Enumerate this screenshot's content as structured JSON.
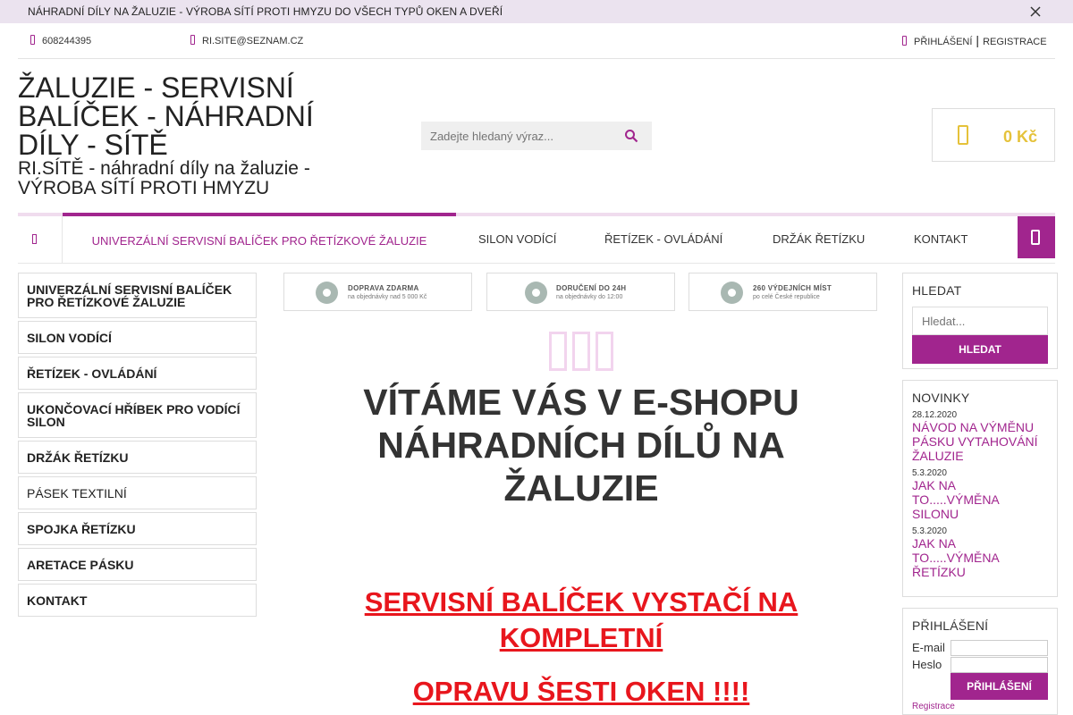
{
  "announcement": {
    "text": "NÁHRADNÍ DÍLY NA ŽALUZIE - VÝROBA SÍTÍ PROTI HMYZU DO VŠECH TYPŮ OKEN A DVEŘÍ"
  },
  "topbar": {
    "phone": "608244395",
    "email": "RI.SITE@SEZNAM.CZ",
    "login": "PŘIHLÁŠENÍ",
    "separator": "|",
    "register": "REGISTRACE"
  },
  "header": {
    "title": "ŽALUZIE - SERVISNÍ BALÍČEK - NÁHRADNÍ DÍLY - SÍTĚ",
    "subtitle": "RI.SÍTĚ - náhradní díly na žaluzie - VÝROBA SÍTÍ PROTI HMYZU",
    "search_placeholder": "Zadejte hledaný výraz...",
    "cart_total": "0 Kč"
  },
  "nav": {
    "items": [
      "UNIVERZÁLNÍ SERVISNÍ BALÍČEK PRO ŘETÍZKOVÉ ŽALUZIE",
      "SILON VODÍCÍ",
      "ŘETÍZEK - OVLÁDÁNÍ",
      "DRŽÁK ŘETÍZKU",
      "KONTAKT"
    ]
  },
  "sidebar": {
    "categories": [
      "UNIVERZÁLNÍ SERVISNÍ BALÍČEK PRO ŘETÍZKOVÉ ŽALUZIE",
      "SILON VODÍCÍ",
      "ŘETÍZEK - OVLÁDÁNÍ",
      "UKONČOVACÍ HŘÍBEK PRO VODÍCÍ SILON",
      "DRŽÁK ŘETÍZKU",
      "PÁSEK TEXTILNÍ",
      "SPOJKA ŘETÍZKU",
      "ARETACE PÁSKU",
      "KONTAKT"
    ]
  },
  "banners": [
    {
      "title": "DOPRAVA ZDARMA",
      "text": "na objednávky nad 5 000 Kč",
      "icon": "truck-icon"
    },
    {
      "title": "DORUČENÍ DO 24H",
      "text": "na objednávky do 12:00",
      "icon": "stopwatch-icon"
    },
    {
      "title": "260 VÝDEJNÍCH MÍST",
      "text": "po celé České republice",
      "icon": "location-pin-icon"
    }
  ],
  "main": {
    "welcome": "VÍTÁME VÁS V E-SHOPU NÁHRADNÍCH DÍLŮ NA ŽALUZIE",
    "promo_1": "SERVISNÍ BALÍČEK VYSTAČÍ NA KOMPLETNÍ",
    "promo_2": "OPRAVU ŠESTI OKEN !!!!"
  },
  "widgets": {
    "search": {
      "title": "HLEDAT",
      "placeholder": "Hledat...",
      "button": "HLEDAT"
    },
    "news": {
      "title": "NOVINKY",
      "items": [
        {
          "date": "28.12.2020",
          "title": "NÁVOD NA VÝMĚNU PÁSKU VYTAHOVÁNÍ ŽALUZIE"
        },
        {
          "date": "5.3.2020",
          "title": "JAK NA TO.....VÝMĚNA SILONU"
        },
        {
          "date": "5.3.2020",
          "title": "JAK NA TO.....VÝMĚNA ŘETÍZKU"
        }
      ]
    },
    "login": {
      "title": "PŘIHLÁŠENÍ",
      "email_label": "E-mail",
      "password_label": "Heslo",
      "button": "PŘIHLÁŠENÍ",
      "register": "Registrace"
    }
  },
  "colors": {
    "accent": "#a1258e",
    "promo": "#e8161d",
    "cart": "#e5c23a",
    "announce_bg": "#ebe3ef"
  }
}
